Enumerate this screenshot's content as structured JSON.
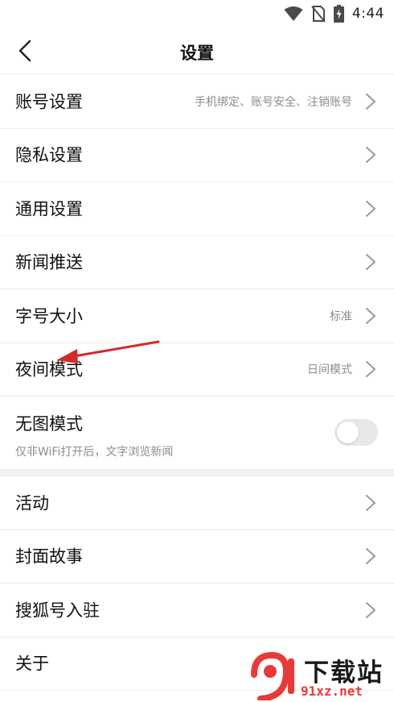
{
  "status_bar": {
    "time": "4:44",
    "icons": [
      "wifi-icon",
      "no-sim-icon",
      "battery-charging-icon"
    ]
  },
  "header": {
    "title": "设置",
    "back_icon": "chevron-left-icon"
  },
  "settings_group_1": [
    {
      "name": "account-settings",
      "label": "账号设置",
      "hint": "手机绑定、账号安全、注销账号"
    },
    {
      "name": "privacy-settings",
      "label": "隐私设置",
      "hint": ""
    },
    {
      "name": "general-settings",
      "label": "通用设置",
      "hint": ""
    },
    {
      "name": "news-push",
      "label": "新闻推送",
      "hint": ""
    },
    {
      "name": "font-size",
      "label": "字号大小",
      "hint": "标准"
    },
    {
      "name": "night-mode",
      "label": "夜间模式",
      "hint": "日间模式"
    }
  ],
  "no_image_mode": {
    "label": "无图模式",
    "description": "仅非WiFi打开后，文字浏览新闻",
    "enabled": false
  },
  "settings_group_2": [
    {
      "name": "activities",
      "label": "活动"
    },
    {
      "name": "cover-story",
      "label": "封面故事"
    },
    {
      "name": "sohu-account-join",
      "label": "搜狐号入驻"
    },
    {
      "name": "about",
      "label": "关于"
    }
  ],
  "watermark": {
    "text": "下载站",
    "url": "91xz.net"
  },
  "colors": {
    "annotation_arrow": "#d42a2a",
    "divider": "#ececec",
    "hint_text": "#8c8c8c",
    "watermark_red": "#e83a3a"
  }
}
